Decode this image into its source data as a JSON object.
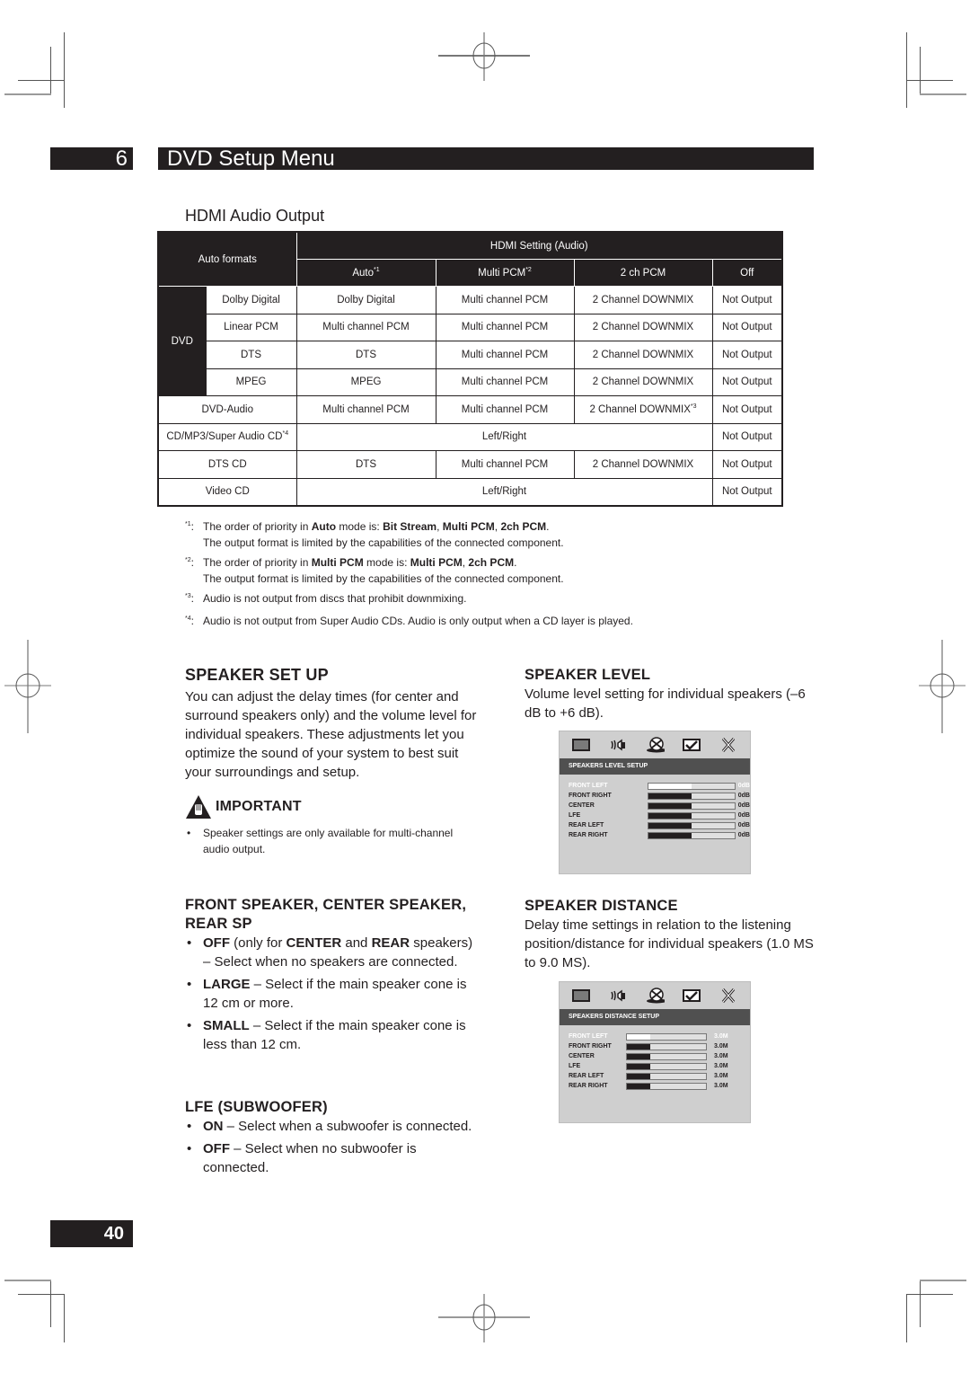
{
  "header": {
    "chapter_number": "6",
    "chapter_title": "DVD Setup Menu"
  },
  "hdmi_section": {
    "title": "HDMI Audio Output",
    "table": {
      "corner_label": "Auto formats",
      "group_header": "HDMI Setting (Audio)",
      "columns": [
        {
          "label": "Auto",
          "note": "*1"
        },
        {
          "label": "Multi PCM",
          "note": "*2"
        },
        {
          "label": "2 ch PCM",
          "note": ""
        },
        {
          "label": "Off",
          "note": ""
        }
      ],
      "dvd_group_label": "DVD",
      "dvd_rows": [
        {
          "format": "Dolby Digital",
          "cells": [
            "Dolby Digital",
            "Multi channel PCM",
            "2 Channel DOWNMIX",
            "Not Output"
          ]
        },
        {
          "format": "Linear PCM",
          "cells": [
            "Multi channel PCM",
            "Multi channel PCM",
            "2 Channel DOWNMIX",
            "Not Output"
          ]
        },
        {
          "format": "DTS",
          "cells": [
            "DTS",
            "Multi channel PCM",
            "2 Channel DOWNMIX",
            "Not Output"
          ]
        },
        {
          "format": "MPEG",
          "cells": [
            "MPEG",
            "Multi channel PCM",
            "2 Channel DOWNMIX",
            "Not Output"
          ]
        }
      ],
      "dvd_audio_row": {
        "format": "DVD-Audio",
        "cells": [
          "Multi channel PCM",
          "Multi channel PCM",
          "2 Channel DOWNMIX",
          "Not Output"
        ],
        "downmix_note": "*3"
      },
      "cd_row": {
        "format": "CD/MP3/Super Audio CD",
        "note": "*4",
        "merged": "Left/Right",
        "off": "Not Output"
      },
      "dtscd_row": {
        "format": "DTS CD",
        "cells": [
          "DTS",
          "Multi channel PCM",
          "2 Channel DOWNMIX",
          "Not Output"
        ]
      },
      "vcd_row": {
        "format": "Video CD",
        "merged": "Left/Right",
        "off": "Not Output"
      }
    },
    "footnotes": [
      {
        "key": "*1",
        "pre": "The order of priority in ",
        "b1": "Auto",
        "mid": " mode is: ",
        "b2": "Bit Stream",
        "s1": ", ",
        "b3": "Multi PCM",
        "s2": ", ",
        "b4": "2ch PCM",
        "end": ".",
        "line2": "The output format is limited by the capabilities of the connected component."
      },
      {
        "key": "*2",
        "pre": "The order of priority in ",
        "b1": "Multi PCM",
        "mid": " mode is: ",
        "b2": "Multi PCM",
        "s1": ", ",
        "b3": "2ch PCM",
        "end": ".",
        "line2": "The output format is limited by the capabilities of the connected component."
      },
      {
        "key": "*3",
        "text": "Audio is not output from discs that prohibit downmixing."
      },
      {
        "key": "*4",
        "text": "Audio is not output from Super Audio CDs. Audio is only output when a CD layer is played."
      }
    ]
  },
  "speaker_setup": {
    "title": "SPEAKER SET UP",
    "body": "You can adjust the delay times (for center and surround speakers only) and the volume level for individual speakers. These adjustments let you optimize the sound of your system to best suit your surroundings and setup.",
    "important_label": "IMPORTANT",
    "important_note": "Speaker settings are only available for multi-channel audio output."
  },
  "front_speaker": {
    "title": "FRONT SPEAKER, CENTER SPEAKER, REAR SP",
    "items": [
      {
        "b1": "OFF",
        "t1": " (only for ",
        "b2": "CENTER",
        "t2": " and ",
        "b3": "REAR",
        "t3": " speakers) – Select when no speakers are connected."
      },
      {
        "b1": "LARGE",
        "t1": " – Select if the main speaker cone is 12 cm or more."
      },
      {
        "b1": "SMALL",
        "t1": " –  Select if the main speaker cone is less than 12 cm."
      }
    ]
  },
  "lfe": {
    "title": "LFE (SUBWOOFER)",
    "items": [
      {
        "b1": "ON",
        "t1": " –  Select when a subwoofer is connected."
      },
      {
        "b1": "OFF",
        "t1": " –  Select when no subwoofer is connected."
      }
    ]
  },
  "speaker_level": {
    "title": "SPEAKER LEVEL",
    "body": "Volume level setting for individual speakers (–6 dB to +6 dB).",
    "osd": {
      "icons": [
        "monitor-icon",
        "speaker-icon",
        "disc-icon",
        "checkbox-icon",
        "close-icon"
      ],
      "title": "SPEAKERS LEVEL SETUP",
      "selected_index": 0,
      "rows": [
        {
          "label": "FRONT LEFT",
          "value": "0dB",
          "fill": 0.5
        },
        {
          "label": "FRONT RIGHT",
          "value": "0dB",
          "fill": 0.5
        },
        {
          "label": "CENTER",
          "value": "0dB",
          "fill": 0.5
        },
        {
          "label": "LFE",
          "value": "0dB",
          "fill": 0.5
        },
        {
          "label": "REAR LEFT",
          "value": "0dB",
          "fill": 0.5
        },
        {
          "label": "REAR RIGHT",
          "value": "0dB",
          "fill": 0.5
        }
      ]
    }
  },
  "speaker_distance": {
    "title": "SPEAKER DISTANCE",
    "body": "Delay time settings in relation to the listening position/distance for individual speakers (1.0 MS to 9.0 MS).",
    "osd": {
      "icons": [
        "monitor-icon",
        "speaker-icon",
        "disc-icon",
        "checkbox-icon",
        "close-icon"
      ],
      "title": "SPEAKERS DISTANCE SETUP",
      "selected_index": 0,
      "rows": [
        {
          "label": "FRONT LEFT",
          "value": "3.0M",
          "fill": 0.3
        },
        {
          "label": "FRONT RIGHT",
          "value": "3.0M",
          "fill": 0.3
        },
        {
          "label": "CENTER",
          "value": "3.0M",
          "fill": 0.3
        },
        {
          "label": "LFE",
          "value": "3.0M",
          "fill": 0.3
        },
        {
          "label": "REAR LEFT",
          "value": "3.0M",
          "fill": 0.3
        },
        {
          "label": "REAR RIGHT",
          "value": "3.0M",
          "fill": 0.3
        }
      ]
    }
  },
  "footer": {
    "page_number": "40"
  }
}
